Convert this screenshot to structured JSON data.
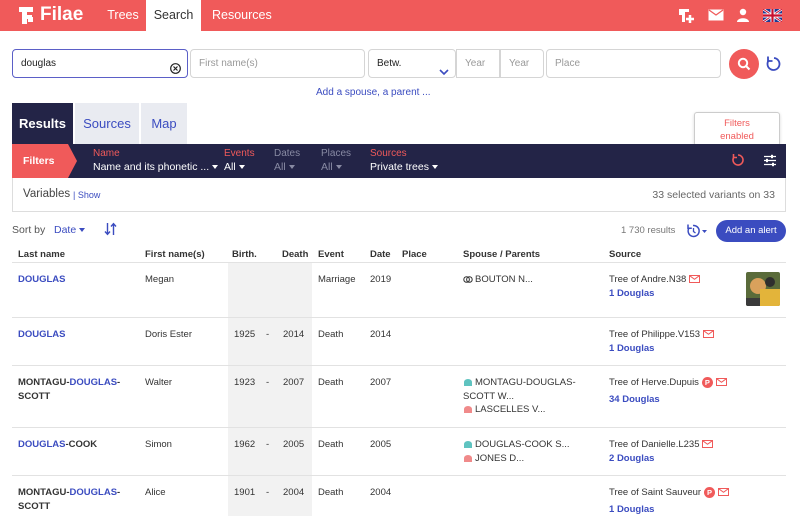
{
  "brand": {
    "name": "Filae"
  },
  "nav": {
    "trees": "Trees",
    "search": "Search",
    "resources": "Resources"
  },
  "search": {
    "last_name": "douglas",
    "first_name_placeholder": "First name(s)",
    "period": "Betw.",
    "year_from_placeholder": "Year",
    "year_to_placeholder": "Year",
    "place_placeholder": "Place",
    "add_spouse": "Add a spouse, a parent ..."
  },
  "tabs": {
    "results": "Results",
    "sources": "Sources",
    "map": "Map"
  },
  "tooltip": {
    "line1": "Filters",
    "line2": "enabled"
  },
  "filters": {
    "label": "Filters",
    "name": {
      "label": "Name",
      "value": "Name and its phonetic ..."
    },
    "events": {
      "label": "Events",
      "value": "All"
    },
    "dates": {
      "label": "Dates",
      "value": "All"
    },
    "places": {
      "label": "Places",
      "value": "All"
    },
    "sources": {
      "label": "Sources",
      "value": "Private trees"
    }
  },
  "variables": {
    "title": "Variables",
    "show": "| Show",
    "count": "33 selected variants on 33"
  },
  "sort": {
    "label": "Sort by",
    "value": "Date",
    "results": "1 730 results",
    "alert_button": "Add an alert"
  },
  "columns": {
    "last_name": "Last name",
    "first_names": "First name(s)",
    "birth": "Birth.",
    "death": "Death",
    "event": "Event",
    "date": "Date",
    "place": "Place",
    "spouse_parents": "Spouse / Parents",
    "source": "Source"
  },
  "rows": [
    {
      "last_a": "",
      "last_hl": "DOUGLAS",
      "last_b": "",
      "last_c": "",
      "first": "Megan",
      "birth": "",
      "dash": "",
      "death": "",
      "event": "Marriage",
      "date": "2019",
      "rel1": "BOUTON N...",
      "rel1b": "",
      "rel2": "",
      "source": "Tree of Andre.N38",
      "count_num": "1",
      "count_name": "Douglas"
    },
    {
      "last_a": "",
      "last_hl": "DOUGLAS",
      "last_b": "",
      "last_c": "",
      "first": "Doris Ester",
      "birth": "1925",
      "dash": "-",
      "death": "2014",
      "event": "Death",
      "date": "2014",
      "rel1": "",
      "rel1b": "",
      "rel2": "",
      "source": "Tree of Philippe.V153",
      "count_num": "1",
      "count_name": "Douglas"
    },
    {
      "last_a": "MONTAGU-",
      "last_hl": "DOUGLAS",
      "last_b": "-",
      "last_c": "SCOTT",
      "first": "Walter",
      "birth": "1923",
      "dash": "-",
      "death": "2007",
      "event": "Death",
      "date": "2007",
      "rel1": "MONTAGU-DOUGLAS-",
      "rel1b": "SCOTT W...",
      "rel2": "LASCELLES V...",
      "source": "Tree of Herve.Dupuis",
      "count_num": "34",
      "count_name": "Douglas",
      "badge": "P"
    },
    {
      "last_a": "",
      "last_hl": "DOUGLAS",
      "last_b": "-COOK",
      "last_c": "",
      "first": "Simon",
      "birth": "1962",
      "dash": "-",
      "death": "2005",
      "event": "Death",
      "date": "2005",
      "rel1": "DOUGLAS-COOK S...",
      "rel1b": "",
      "rel2": "JONES D...",
      "source": "Tree of Danielle.L235",
      "count_num": "2",
      "count_name": "Douglas"
    },
    {
      "last_a": "MONTAGU-",
      "last_hl": "DOUGLAS",
      "last_b": "-",
      "last_c": "SCOTT",
      "first": "Alice",
      "birth": "1901",
      "dash": "-",
      "death": "2004",
      "event": "Death",
      "date": "2004",
      "rel1": "",
      "rel1b": "",
      "rel2": "",
      "source": "Tree of Saint Sauveur",
      "count_num": "1",
      "count_name": "Douglas",
      "badge": "P"
    }
  ],
  "colors": {
    "accent": "#f05a5a",
    "navy": "#232447",
    "link": "#3b4cc0"
  }
}
